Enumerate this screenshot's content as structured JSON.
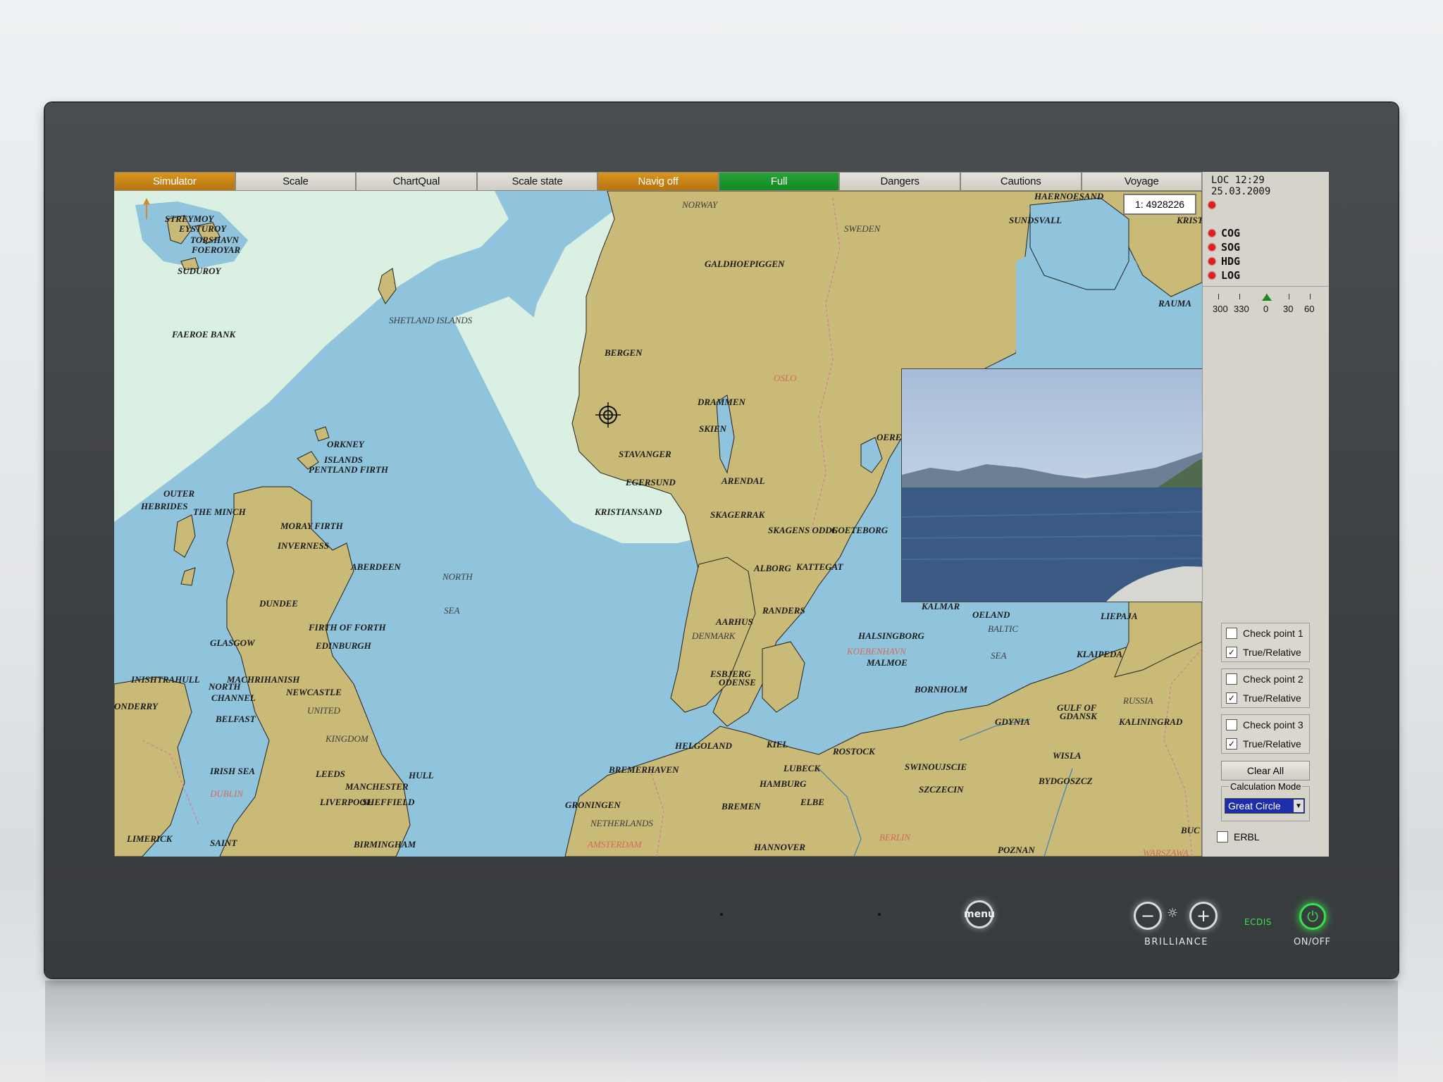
{
  "toolbar": {
    "buttons": [
      {
        "label": "Simulator",
        "state": "orange"
      },
      {
        "label": "Scale",
        "state": "normal"
      },
      {
        "label": "ChartQual",
        "state": "normal"
      },
      {
        "label": "Scale state",
        "state": "normal"
      },
      {
        "label": "Navig off",
        "state": "orange"
      },
      {
        "label": "Full",
        "state": "green"
      },
      {
        "label": "Dangers",
        "state": "normal"
      },
      {
        "label": "Cautions",
        "state": "normal"
      },
      {
        "label": "Voyage",
        "state": "normal"
      }
    ]
  },
  "chart": {
    "scale": "1: 4928226",
    "places": [
      {
        "t": "NORWAY",
        "s": "light"
      },
      {
        "t": "SWEDEN",
        "s": "light"
      },
      {
        "t": "GALDHOEPIGGEN",
        "s": ""
      },
      {
        "t": "SHETLAND ISLANDS",
        "s": "light"
      },
      {
        "t": "BERGEN",
        "s": ""
      },
      {
        "t": "OSLO",
        "s": "red"
      },
      {
        "t": "DRAMMEN",
        "s": ""
      },
      {
        "t": "SKIEN",
        "s": ""
      },
      {
        "t": "STAVANGER",
        "s": ""
      },
      {
        "t": "EGERSUND",
        "s": ""
      },
      {
        "t": "ARENDAL",
        "s": ""
      },
      {
        "t": "KRISTIANSAND",
        "s": ""
      },
      {
        "t": "SKAGERRAK",
        "s": ""
      },
      {
        "t": "SKAGENS ODDE",
        "s": ""
      },
      {
        "t": "GOETEBORG",
        "s": ""
      },
      {
        "t": "ALBORG",
        "s": ""
      },
      {
        "t": "KATTEGAT",
        "s": ""
      },
      {
        "t": "RANDERS",
        "s": ""
      },
      {
        "t": "AARHUS",
        "s": ""
      },
      {
        "t": "DENMARK",
        "s": "light"
      },
      {
        "t": "HALSINGBORG",
        "s": ""
      },
      {
        "t": "KOEBENHAVN",
        "s": "red"
      },
      {
        "t": "MALMOE",
        "s": ""
      },
      {
        "t": "ESBJERG",
        "s": ""
      },
      {
        "t": "ODENSE",
        "s": ""
      },
      {
        "t": "BORNHOLM",
        "s": ""
      },
      {
        "t": "KALMAR",
        "s": ""
      },
      {
        "t": "OELAND",
        "s": ""
      },
      {
        "t": "BALTIC",
        "s": "light"
      },
      {
        "t": "SEA",
        "s": "light"
      },
      {
        "t": "LIEPAJA",
        "s": ""
      },
      {
        "t": "KLAIPEDA",
        "s": ""
      },
      {
        "t": "RUSSIA",
        "s": "light"
      },
      {
        "t": "GULF OF",
        "s": ""
      },
      {
        "t": "GDANSK",
        "s": ""
      },
      {
        "t": "KALININGRAD",
        "s": ""
      },
      {
        "t": "GDYNIA",
        "s": ""
      },
      {
        "t": "WISLA",
        "s": ""
      },
      {
        "t": "BYDGOSZCZ",
        "s": ""
      },
      {
        "t": "POZNAN",
        "s": ""
      },
      {
        "t": "WARSZAWA",
        "s": "red"
      },
      {
        "t": "BERLIN",
        "s": "red"
      },
      {
        "t": "SZCZECIN",
        "s": ""
      },
      {
        "t": "SWINOUJSCIE",
        "s": ""
      },
      {
        "t": "ROSTOCK",
        "s": ""
      },
      {
        "t": "LUBECK",
        "s": ""
      },
      {
        "t": "KIEL",
        "s": ""
      },
      {
        "t": "HAMBURG",
        "s": ""
      },
      {
        "t": "ELBE",
        "s": ""
      },
      {
        "t": "BREMEN",
        "s": ""
      },
      {
        "t": "HANNOVER",
        "s": ""
      },
      {
        "t": "BREMERHAVEN",
        "s": ""
      },
      {
        "t": "HELGOLAND",
        "s": ""
      },
      {
        "t": "GRONINGEN",
        "s": ""
      },
      {
        "t": "NETHERLANDS",
        "s": "light"
      },
      {
        "t": "AMSTERDAM",
        "s": "red"
      },
      {
        "t": "NORTH",
        "s": "light"
      },
      {
        "t": "SEA",
        "s": "light"
      },
      {
        "t": "ORKNEY",
        "s": ""
      },
      {
        "t": "ISLANDS",
        "s": ""
      },
      {
        "t": "PENTLAND FIRTH",
        "s": ""
      },
      {
        "t": "OUTER",
        "s": ""
      },
      {
        "t": "HEBRIDES",
        "s": ""
      },
      {
        "t": "THE MINCH",
        "s": ""
      },
      {
        "t": "MORAY FIRTH",
        "s": ""
      },
      {
        "t": "INVERNESS",
        "s": ""
      },
      {
        "t": "ABERDEEN",
        "s": ""
      },
      {
        "t": "DUNDEE",
        "s": ""
      },
      {
        "t": "FIRTH OF FORTH",
        "s": ""
      },
      {
        "t": "EDINBURGH",
        "s": ""
      },
      {
        "t": "GLASGOW",
        "s": ""
      },
      {
        "t": "INISHTRAHULL",
        "s": ""
      },
      {
        "t": "MACHRIHANISH",
        "s": ""
      },
      {
        "t": "NORTH",
        "s": ""
      },
      {
        "t": "CHANNEL",
        "s": ""
      },
      {
        "t": "NEWCASTLE",
        "s": ""
      },
      {
        "t": "UNITED",
        "s": "light"
      },
      {
        "t": "KINGDOM",
        "s": "light"
      },
      {
        "t": "BELFAST",
        "s": ""
      },
      {
        "t": "ONDERRY",
        "s": ""
      },
      {
        "t": "IRISH SEA",
        "s": ""
      },
      {
        "t": "DUBLIN",
        "s": "red"
      },
      {
        "t": "LEEDS",
        "s": ""
      },
      {
        "t": "HULL",
        "s": ""
      },
      {
        "t": "MANCHESTER",
        "s": ""
      },
      {
        "t": "LIVERPOOL",
        "s": ""
      },
      {
        "t": "SHEFFIELD",
        "s": ""
      },
      {
        "t": "LIMERICK",
        "s": ""
      },
      {
        "t": "SAINT",
        "s": ""
      },
      {
        "t": "BIRMINGHAM",
        "s": ""
      },
      {
        "t": "STREYMOY",
        "s": ""
      },
      {
        "t": "EYSTUROY",
        "s": ""
      },
      {
        "t": "TORSHAVN",
        "s": ""
      },
      {
        "t": "FOEROYAR",
        "s": ""
      },
      {
        "t": "SUDUROY",
        "s": ""
      },
      {
        "t": "FAEROE BANK",
        "s": ""
      },
      {
        "t": "HAERNOESAND",
        "s": ""
      },
      {
        "t": "SUNDSVALL",
        "s": ""
      },
      {
        "t": "KRISTINES",
        "s": ""
      },
      {
        "t": "RAUMA",
        "s": ""
      },
      {
        "t": "OERE",
        "s": ""
      },
      {
        "t": "BUC",
        "s": ""
      }
    ]
  },
  "panel": {
    "loc_time": "LOC 12:29 25.03.2009",
    "sensors": [
      "COG",
      "SOG",
      "HDG",
      "LOG"
    ],
    "ruler_labels": [
      "300",
      "330",
      "0",
      "30",
      "60"
    ],
    "checkpoints": [
      {
        "label": "Check point 1",
        "checked": false,
        "sub_label": "True/Relative",
        "sub_checked": true
      },
      {
        "label": "Check point 2",
        "checked": false,
        "sub_label": "True/Relative",
        "sub_checked": true
      },
      {
        "label": "Check point 3",
        "checked": false,
        "sub_label": "True/Relative",
        "sub_checked": true
      }
    ],
    "clear_all": "Clear All",
    "calc_mode_legend": "Calculation Mode",
    "calc_mode_value": "Great Circle",
    "ebrl_label": "ERBL",
    "check_mark": "✓"
  },
  "hardware": {
    "menu_label": "menu",
    "brilliance_label": "BRILLIANCE",
    "ecdis_label": "ECDIS",
    "onoff_label": "ON/OFF",
    "minus_symbol": "−",
    "plus_symbol": "+",
    "sun_symbol": "☼",
    "power_symbol": "⏻",
    "accent_green": "#37e04a"
  }
}
